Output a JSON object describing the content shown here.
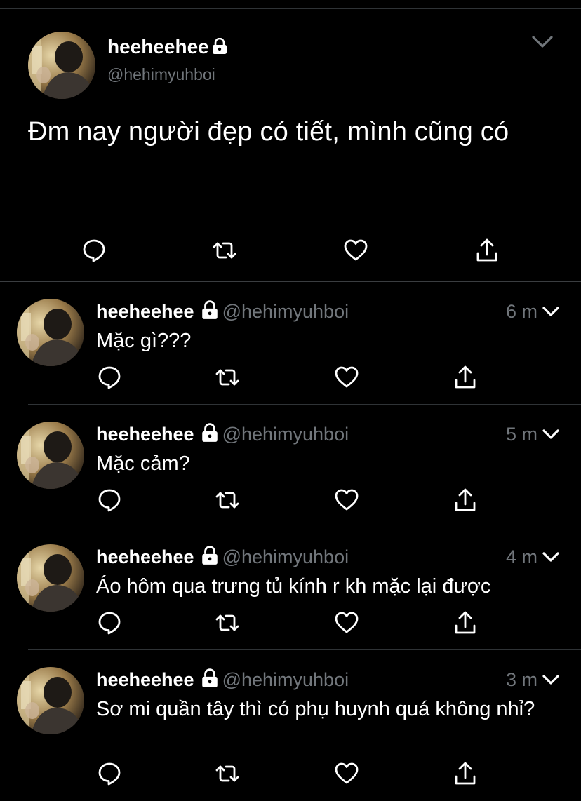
{
  "main_tweet": {
    "name": "heeheehee",
    "handle": "@hehimyuhboi",
    "text": "Đm nay người đẹp có tiết, mình cũng có",
    "protected_icon": "lock-icon",
    "menu_icon": "chevron-down-icon",
    "actions": [
      "reply-icon",
      "retweet-icon",
      "like-icon",
      "share-icon"
    ]
  },
  "replies": [
    {
      "name": "heeheehee",
      "handle": "@hehimyuhboi",
      "time": "6 m",
      "text": "Mặc gì???"
    },
    {
      "name": "heeheehee",
      "handle": "@hehimyuhboi",
      "time": "5 m",
      "text": "Mặc cảm?"
    },
    {
      "name": "heeheehee",
      "handle": "@hehimyuhboi",
      "time": "4 m",
      "text": "Áo hôm qua trưng tủ kính r kh mặc lại được"
    },
    {
      "name": "heeheehee",
      "handle": "@hehimyuhboi",
      "time": "3 m",
      "text": "Sơ mi quần tây thì có phụ huynh quá không nhỉ?"
    }
  ],
  "colors": {
    "background": "#000000",
    "text": "#ffffff",
    "secondary_text": "#71767b",
    "divider": "#2f3336"
  }
}
